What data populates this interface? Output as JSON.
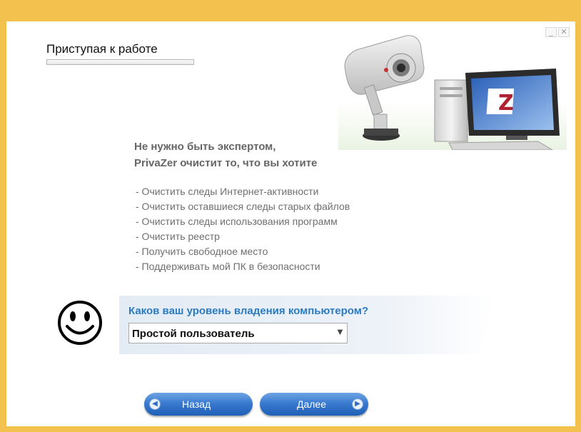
{
  "window": {
    "minimize_glyph": "_",
    "close_glyph": "✕"
  },
  "page": {
    "title": "Приступая к работе",
    "headline_line1": "Не нужно быть экспертом,",
    "headline_line2": "PrivaZer очистит то, что вы хотите",
    "features": [
      "- Очистить следы Интернет-активности",
      "- Очистить оставшиеся следы старых файлов",
      "- Очистить следы использования программ",
      "- Очистить реестр",
      "- Получить свободное место",
      "- Поддерживать мой ПК в безопасности"
    ],
    "progress": 0
  },
  "question": {
    "label": "Каков ваш уровень владения компьютером?",
    "selected": "Простой пользователь"
  },
  "buttons": {
    "back": "Назад",
    "next": "Далее"
  },
  "icons": {
    "hero": "camera-and-computer-illustration",
    "smiley": "smiley-face-icon",
    "back": "arrow-left-icon",
    "next": "arrow-right-icon"
  },
  "colors": {
    "window_frame": "#f3c14e",
    "question_text": "#2b7bc3",
    "button_blue": "#3a7bd0"
  }
}
